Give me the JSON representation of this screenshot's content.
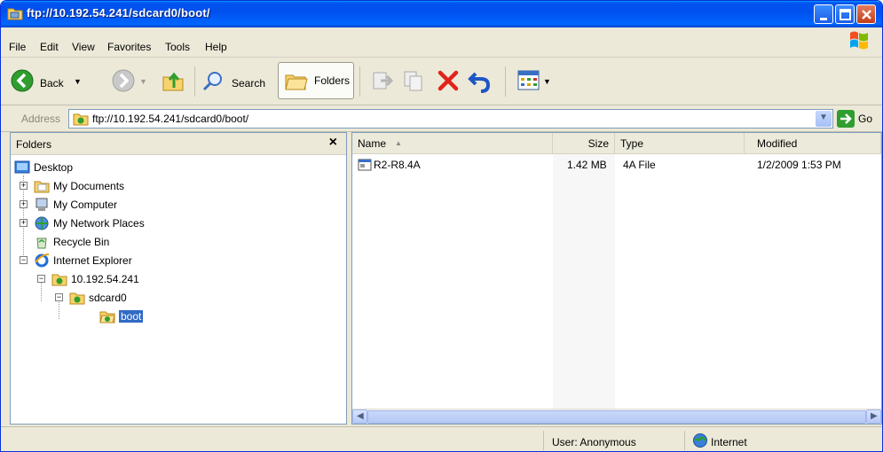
{
  "window": {
    "title": "ftp://10.192.54.241/sdcard0/boot/"
  },
  "menu": {
    "items": [
      "File",
      "Edit",
      "View",
      "Favorites",
      "Tools",
      "Help"
    ]
  },
  "toolbar": {
    "back_label": "Back",
    "search_label": "Search",
    "folders_label": "Folders"
  },
  "address": {
    "label": "Address",
    "value": "ftp://10.192.54.241/sdcard0/boot/",
    "go_label": "Go"
  },
  "folders_panel": {
    "header": "Folders",
    "close_glyph": "×",
    "tree": [
      {
        "label": "Desktop",
        "icon": "desktop-icon"
      },
      {
        "label": "My Documents",
        "icon": "my-documents-icon"
      },
      {
        "label": "My Computer",
        "icon": "my-computer-icon"
      },
      {
        "label": "My Network Places",
        "icon": "network-places-icon"
      },
      {
        "label": "Recycle Bin",
        "icon": "recycle-bin-icon"
      },
      {
        "label": "Internet Explorer",
        "icon": "internet-explorer-icon"
      },
      {
        "label": "10.192.54.241",
        "icon": "ftp-server-icon"
      },
      {
        "label": "sdcard0",
        "icon": "ftp-folder-icon"
      },
      {
        "label": "boot",
        "icon": "ftp-folder-open-icon",
        "selected": true
      }
    ]
  },
  "file_list": {
    "columns": [
      "Name",
      "Size",
      "Type",
      "Modified"
    ],
    "rows": [
      {
        "name": "R2-R8.4A",
        "size": "1.42 MB",
        "type": "4A File",
        "modified": "1/2/2009 1:53 PM"
      }
    ]
  },
  "status": {
    "user": "User: Anonymous",
    "zone": "Internet"
  },
  "colors": {
    "titlebar": "#0050ee",
    "selection": "#316ac5",
    "chrome": "#ece9d8"
  }
}
